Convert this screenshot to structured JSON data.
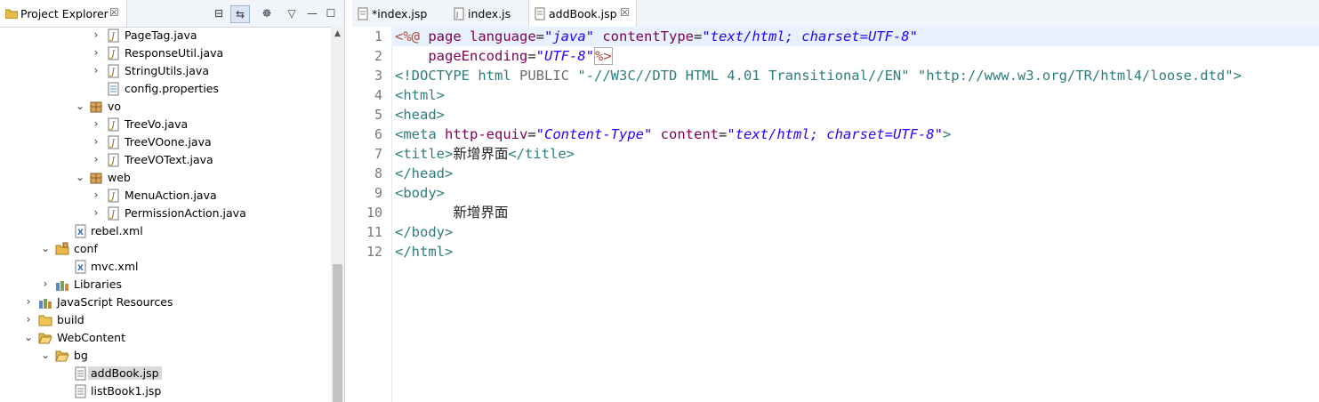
{
  "project_explorer": {
    "tab_label": "Project Explorer",
    "tab_close": "☒",
    "toolbar": {
      "collapse": "⊟",
      "link": "⇆",
      "filter": "☸",
      "menu": "▽",
      "minimize": "—",
      "maximize": "☐"
    },
    "tree": [
      {
        "label": "PageTag.java",
        "twisty": "›",
        "icon": "java-file-icon"
      },
      {
        "label": "ResponseUtil.java",
        "twisty": "›",
        "icon": "java-file-icon"
      },
      {
        "label": "StringUtils.java",
        "twisty": "›",
        "icon": "java-file-icon"
      },
      {
        "label": "config.properties",
        "twisty": "",
        "icon": "properties-file-icon"
      },
      {
        "label": "vo",
        "twisty": "⌄",
        "icon": "package-icon"
      },
      {
        "label": "TreeVo.java",
        "twisty": "›",
        "icon": "java-file-icon"
      },
      {
        "label": "TreeVOone.java",
        "twisty": "›",
        "icon": "java-file-icon"
      },
      {
        "label": "TreeVOText.java",
        "twisty": "›",
        "icon": "java-file-icon"
      },
      {
        "label": "web",
        "twisty": "⌄",
        "icon": "package-icon"
      },
      {
        "label": "MenuAction.java",
        "twisty": "›",
        "icon": "java-file-icon"
      },
      {
        "label": "PermissionAction.java",
        "twisty": "›",
        "icon": "java-file-icon"
      },
      {
        "label": "rebel.xml",
        "twisty": "",
        "icon": "xml-file-icon"
      },
      {
        "label": "conf",
        "twisty": "⌄",
        "icon": "source-folder-icon"
      },
      {
        "label": "mvc.xml",
        "twisty": "",
        "icon": "xml-file-icon"
      },
      {
        "label": "Libraries",
        "twisty": "›",
        "icon": "libraries-icon"
      },
      {
        "label": "JavaScript Resources",
        "twisty": "›",
        "icon": "js-resources-icon"
      },
      {
        "label": "build",
        "twisty": "›",
        "icon": "folder-icon"
      },
      {
        "label": "WebContent",
        "twisty": "⌄",
        "icon": "folder-open-icon"
      },
      {
        "label": "bg",
        "twisty": "⌄",
        "icon": "folder-open-icon"
      },
      {
        "label": "addBook.jsp",
        "twisty": "",
        "icon": "jsp-file-icon",
        "selected": true
      },
      {
        "label": "listBook1.jsp",
        "twisty": "",
        "icon": "jsp-file-icon"
      }
    ]
  },
  "editor": {
    "tabs": [
      {
        "label": "*index.jsp",
        "icon": "jsp-file-icon",
        "active": false
      },
      {
        "label": "index.js",
        "icon": "js-file-icon",
        "active": false
      },
      {
        "label": "addBook.jsp",
        "icon": "jsp-file-icon",
        "active": true,
        "close": "☒"
      }
    ],
    "line_numbers": [
      "1",
      "2",
      "3",
      "4",
      "5",
      "6",
      "7",
      "8",
      "9",
      "10",
      "11",
      "12"
    ],
    "code": {
      "l1": {
        "a": "<%@ ",
        "b": "page ",
        "c": "language",
        "d": "=",
        "e": "\"java\"",
        "f": " contentType",
        "g": "=",
        "h": "\"text/html; charset=UTF-8\""
      },
      "l2": {
        "a": "    pageEncoding",
        "b": "=",
        "c": "\"UTF-8\"",
        "d": "%>"
      },
      "l3": {
        "a": "<!DOCTYPE ",
        "b": "html ",
        "c": "PUBLIC ",
        "d": "\"-//W3C//DTD HTML 4.01 Transitional//EN\"",
        "e": " ",
        "f": "\"http://www.w3.org/TR/html4/loose.dtd\"",
        "g": ">"
      },
      "l4": {
        "a": "<html>"
      },
      "l5": {
        "a": "<head>"
      },
      "l6": {
        "a": "<meta ",
        "b": "http-equiv",
        "c": "=",
        "d": "\"Content-Type\"",
        "e": " content",
        "f": "=",
        "g": "\"text/html; charset=UTF-8\"",
        "h": ">"
      },
      "l7": {
        "a": "<title>",
        "b": "新增界面",
        "c": "</title>"
      },
      "l8": {
        "a": "</head>"
      },
      "l9": {
        "a": "<body>"
      },
      "l10": {
        "a": "       新增界面"
      },
      "l11": {
        "a": "</body>"
      },
      "l12": {
        "a": "</html>"
      }
    }
  },
  "colors": {
    "jsp_delim": "#b24a3a",
    "attribute": "#7f0055",
    "tag": "#2e7d7d",
    "string": "#2a00ff",
    "doctype_string": "#2a5fa8",
    "current_line": "#e8f2fe",
    "selection": "#d9d9d9"
  }
}
